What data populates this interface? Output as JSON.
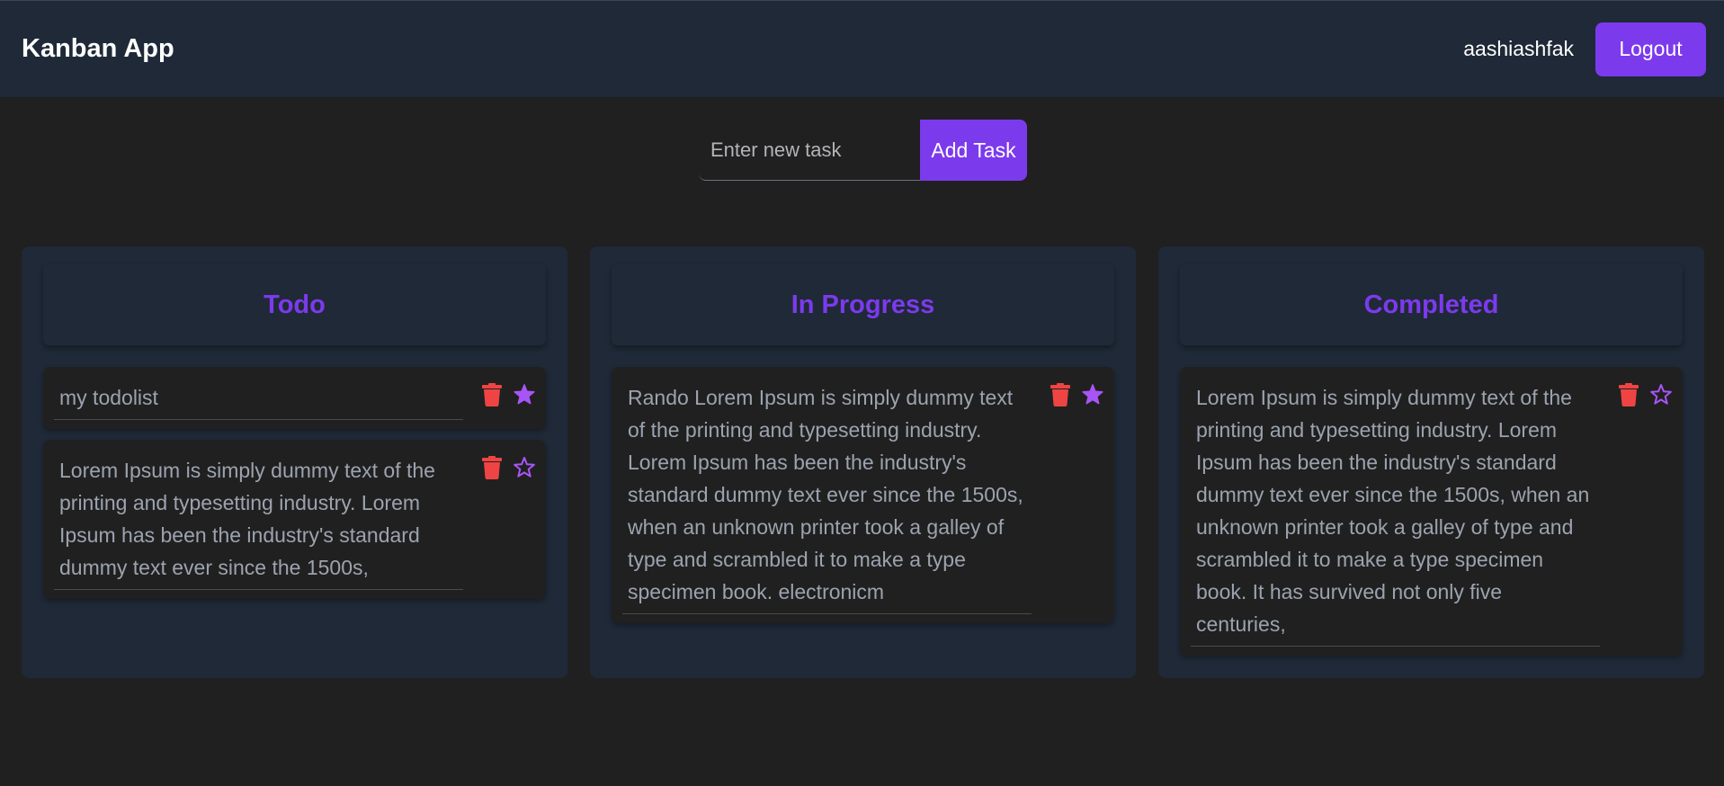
{
  "navbar": {
    "brand": "Kanban App",
    "username": "aashiashfak",
    "logout_label": "Logout"
  },
  "add_task": {
    "placeholder": "Enter new task",
    "button_label": "Add Task"
  },
  "colors": {
    "accent": "#7c3aed",
    "delete": "#ef4444",
    "panel": "#1f2937",
    "background": "#202020"
  },
  "columns": [
    {
      "title": "Todo",
      "cards": [
        {
          "text": "my todolist",
          "starred": true
        },
        {
          "text": "Lorem Ipsum is simply dummy text of the printing and typesetting industry. Lorem Ipsum has been the industry's standard dummy text ever since the 1500s,",
          "starred": false
        }
      ]
    },
    {
      "title": "In Progress",
      "cards": [
        {
          "text": "Rando Lorem Ipsum is simply dummy text of the printing and typesetting industry. Lorem Ipsum has been the industry's standard dummy text ever since the 1500s, when an unknown printer took a galley of type and scrambled it to make a type specimen book. electronicm",
          "starred": true
        }
      ]
    },
    {
      "title": "Completed",
      "cards": [
        {
          "text": "Lorem Ipsum is simply dummy text of the printing and typesetting industry. Lorem Ipsum has been the industry's standard dummy text ever since the 1500s, when an unknown printer took a galley of type and scrambled it to make a type specimen book. It has survived not only five centuries,",
          "starred": false
        }
      ]
    }
  ],
  "icons": {
    "delete": "trash-icon",
    "star": "star-icon"
  }
}
